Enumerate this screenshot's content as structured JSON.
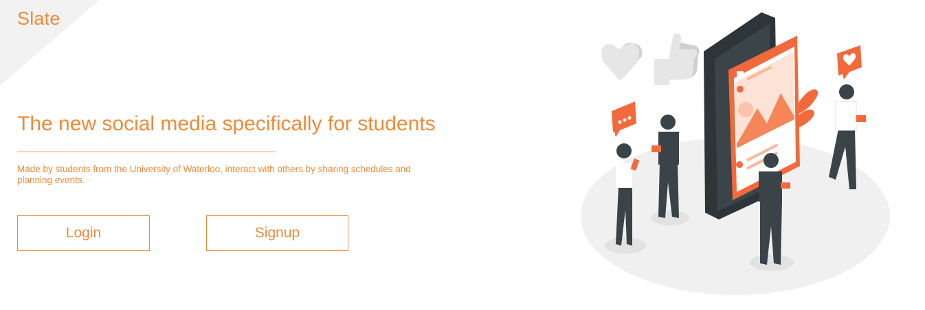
{
  "brand": {
    "name": "Slate"
  },
  "hero": {
    "headline": "The new social media specifically for students",
    "description": "Made by students from the University of Waterloo, interact with others by sharing schedules and planning events."
  },
  "actions": {
    "login_label": "Login",
    "signup_label": "Signup"
  },
  "colors": {
    "accent": "#f08a38",
    "illustration_accent": "#f26a3b",
    "figure_dark": "#3a4347",
    "corner_bg": "#f2f2f2"
  },
  "illustration": {
    "icons": [
      "heart-icon",
      "thumbs-up-icon",
      "chat-bubble-icon",
      "heart-bubble-icon",
      "camera-icon",
      "image-icon"
    ]
  }
}
